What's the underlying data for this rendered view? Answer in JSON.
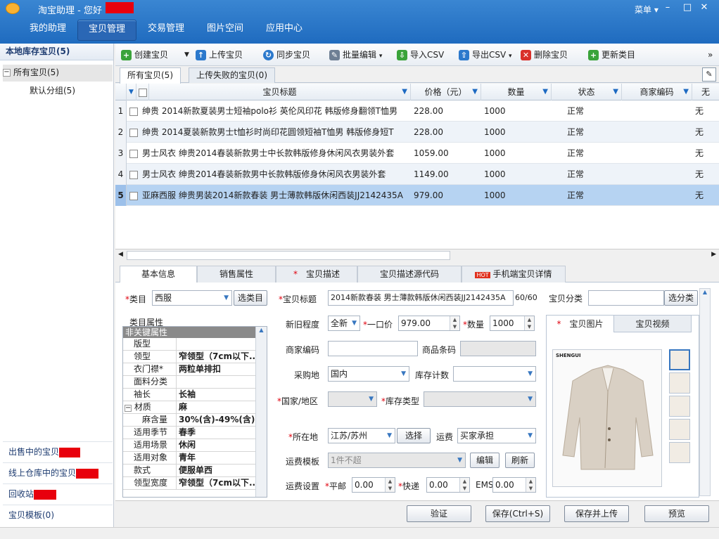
{
  "window": {
    "app_title": "淘宝助理 - 您好",
    "menu_label": "菜单",
    "minimize": "–",
    "maximize": "□",
    "close": "✕"
  },
  "nav_tabs": [
    {
      "label": "我的助理"
    },
    {
      "label": "宝贝管理"
    },
    {
      "label": "交易管理"
    },
    {
      "label": "图片空间"
    },
    {
      "label": "应用中心"
    }
  ],
  "left": {
    "header": "本地库存宝贝(5)",
    "tree_all": "所有宝贝(5)",
    "tree_expand": "−",
    "tree_default": "默认分组(5)",
    "bottom_items": [
      {
        "label": "出售中的宝贝"
      },
      {
        "label": "线上仓库中的宝贝"
      },
      {
        "label": "回收站"
      },
      {
        "label": "宝贝模板(0)"
      }
    ]
  },
  "toolbar": {
    "items": [
      {
        "label": "创建宝贝",
        "icon": "+"
      },
      {
        "label": "上传宝贝",
        "icon": "↑"
      },
      {
        "label": "同步宝贝",
        "icon": "↻"
      },
      {
        "label": "批量编辑",
        "icon": "✎"
      },
      {
        "label": "导入CSV",
        "icon": "⇩"
      },
      {
        "label": "导出CSV",
        "icon": "⇧"
      },
      {
        "label": "删除宝贝",
        "icon": "✕"
      },
      {
        "label": "更新类目",
        "icon": "+"
      }
    ],
    "more": "»"
  },
  "list_tabs": [
    {
      "label": "所有宝贝(5)"
    },
    {
      "label": "上传失败的宝贝(0)"
    }
  ],
  "grid": {
    "columns": [
      "宝贝标题",
      "价格（元）",
      "数量",
      "状态",
      "商家编码",
      "无"
    ],
    "rows": [
      {
        "num": "1",
        "title": "绅贵 2014新款夏装男士短袖polo衫 英伦风印花 韩版修身翻领T恤男",
        "price": "228.00",
        "qty": "1000",
        "status": "正常",
        "code": "",
        "extra": "无"
      },
      {
        "num": "2",
        "title": "绅贵 2014夏装新款男士t恤衫时尚印花圆领短袖T恤男 韩版修身短T",
        "price": "228.00",
        "qty": "1000",
        "status": "正常",
        "code": "",
        "extra": "无"
      },
      {
        "num": "3",
        "title": "男士风衣 绅贵2014春装新款男士中长款韩版修身休闲风衣男装外套",
        "price": "1059.00",
        "qty": "1000",
        "status": "正常",
        "code": "",
        "extra": "无"
      },
      {
        "num": "4",
        "title": "男士风衣 绅贵2014春装新款男中长款韩版修身休闲风衣男装外套",
        "price": "1149.00",
        "qty": "1000",
        "status": "正常",
        "code": "",
        "extra": "无"
      },
      {
        "num": "5",
        "title": "亚麻西服 绅贵男装2014新款春装 男士薄款韩版休闲西装JJ2142435A",
        "price": "979.00",
        "qty": "1000",
        "status": "正常",
        "code": "",
        "extra": "无"
      }
    ]
  },
  "detail_tabs": [
    {
      "label": "基本信息"
    },
    {
      "label": "销售属性"
    },
    {
      "label": "宝贝描述"
    },
    {
      "label": "宝贝描述源代码"
    },
    {
      "label": "手机端宝贝详情",
      "badge": "HOT"
    }
  ],
  "form": {
    "category_label": "类目",
    "category_value": "西服",
    "select_category": "选类目",
    "attrs_title": "类目属性",
    "attrs_header": "非关键属性",
    "attrs": [
      {
        "name": "版型",
        "value": ""
      },
      {
        "name": "领型",
        "value": "窄领型（7cm以下..."
      },
      {
        "name": "衣门襟*",
        "value": "两粒单排扣"
      },
      {
        "name": "面料分类",
        "value": ""
      },
      {
        "name": "袖长",
        "value": "长袖"
      },
      {
        "name": "材质",
        "value": "麻"
      },
      {
        "name": "麻含量",
        "value": "30%(含)-49%(含)"
      },
      {
        "name": "适用季节",
        "value": "春季"
      },
      {
        "name": "适用场景",
        "value": "休闲"
      },
      {
        "name": "适用对象",
        "value": "青年"
      },
      {
        "name": "款式",
        "value": "便服单西"
      },
      {
        "name": "领型宽度",
        "value": "窄领型（7cm以下..."
      }
    ],
    "title_label": "宝贝标题",
    "title_value": "2014新款春装 男士薄款韩版休闲西装JJ2142435A",
    "title_count": "60/60",
    "cat2_label": "宝贝分类",
    "cat2_button": "选分类",
    "condition_label": "新旧程度",
    "condition_value": "全新",
    "price_label": "一口价",
    "price_value": "979.00",
    "qty_label": "数量",
    "qty_value": "1000",
    "merchant_code_label": "商家编码",
    "barcode_label": "商品条码",
    "origin_label": "采购地",
    "origin_value": "国内",
    "stock_count_label": "库存计数",
    "country_label": "国家/地区",
    "stock_type_label": "库存类型",
    "location_label": "所在地",
    "location_value": "江苏/苏州",
    "location_button": "选择",
    "shipping_label": "运费",
    "shipping_value": "买家承担",
    "ship_template_label": "运费模板",
    "ship_template_value": "1件不超",
    "edit_button": "编辑",
    "refresh_button": "刷新",
    "ship_settings_label": "运费设置",
    "post_label": "平邮",
    "post_value": "0.00",
    "express_label": "快递",
    "express_value": "0.00",
    "ems_label": "EMS",
    "ems_value": "0.00"
  },
  "photo": {
    "tab_images": "宝贝图片",
    "tab_video": "宝贝视频",
    "brand_text": "SHENGUI"
  },
  "bottom_buttons": [
    {
      "label": "验证"
    },
    {
      "label": "保存(Ctrl+S)"
    },
    {
      "label": "保存并上传"
    },
    {
      "label": "预览"
    }
  ],
  "colors": {
    "titlebar": "#2a74c6",
    "selected_row": "#b6d3f2",
    "required_star": "#e0000d",
    "redaction": "#e8000d"
  }
}
